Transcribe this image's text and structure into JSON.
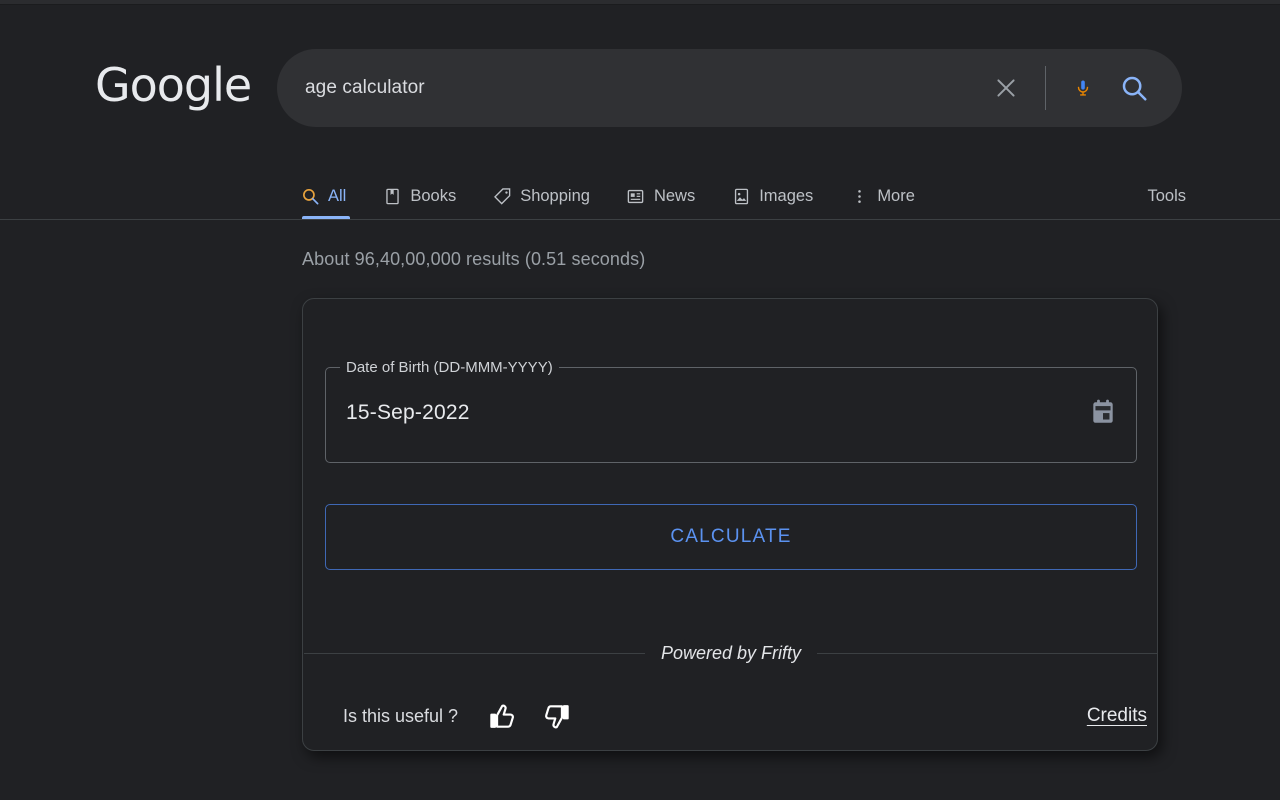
{
  "brand": {
    "logo_text": "Google",
    "logo_color": "#e8eaed"
  },
  "search": {
    "query": "age calculator",
    "placeholder": "Search",
    "clear_icon": "close-icon",
    "mic_icon": "microphone-icon",
    "search_icon": "search-icon",
    "accent_color": "#8ab4f8"
  },
  "nav": {
    "tabs": [
      {
        "label": "All",
        "icon": "search-icon",
        "active": true
      },
      {
        "label": "Books",
        "icon": "book-icon",
        "active": false
      },
      {
        "label": "Shopping",
        "icon": "tag-icon",
        "active": false
      },
      {
        "label": "News",
        "icon": "newspaper-icon",
        "active": false
      },
      {
        "label": "Images",
        "icon": "image-icon",
        "active": false
      },
      {
        "label": "More",
        "icon": "more-vertical-icon",
        "active": false
      }
    ],
    "tools_label": "Tools"
  },
  "results": {
    "stats": "About 96,40,00,000 results (0.51 seconds)"
  },
  "calculator": {
    "dob_label": "Date of Birth (DD-MMM-YYYY)",
    "dob_value": "15-Sep-2022",
    "calendar_icon": "calendar-icon",
    "calculate_label": "CALCULATE",
    "calculate_color": "#5b92f0",
    "powered_by": "Powered by Frifty",
    "useful_label": "Is this useful ?",
    "thumbs_up_icon": "thumbs-up-icon",
    "thumbs_down_icon": "thumbs-down-icon",
    "credits_label": "Credits"
  }
}
